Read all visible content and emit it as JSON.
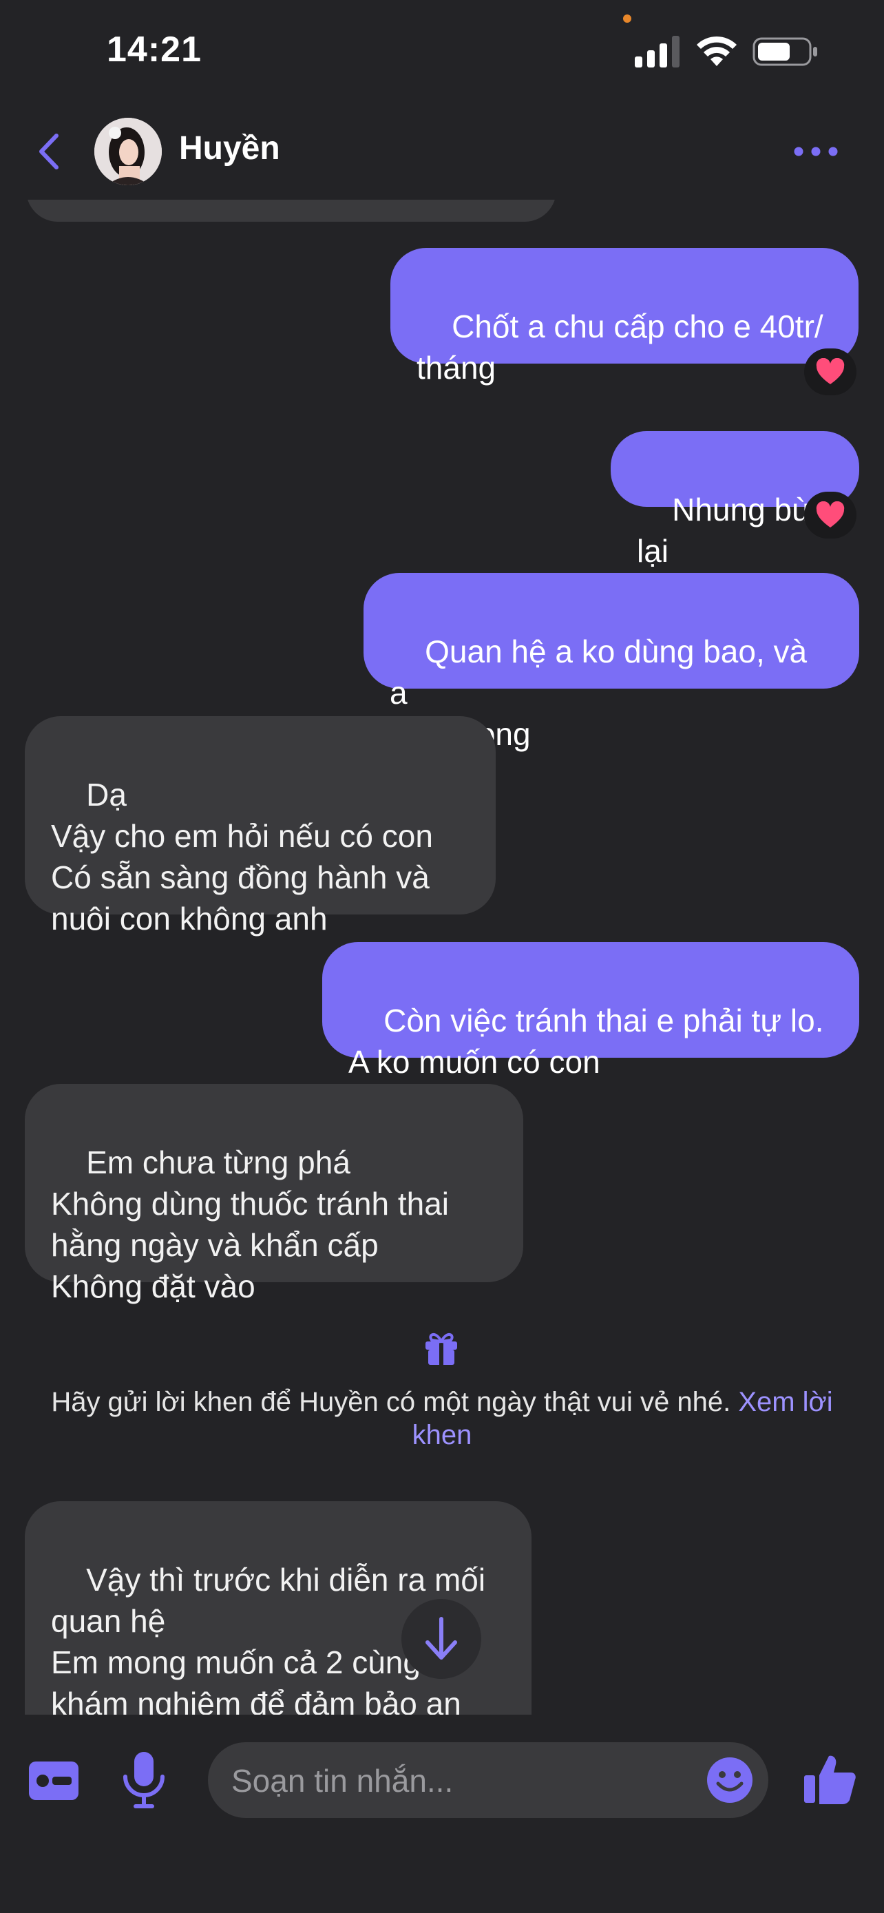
{
  "status_bar": {
    "time": "14:21"
  },
  "header": {
    "contact_name": "Huyền"
  },
  "messages": [
    {
      "direction": "out",
      "text": "Chốt a chu cấp cho e 40tr/\ntháng",
      "reaction": "heart"
    },
    {
      "direction": "out",
      "text": "Nhung bù lại",
      "reaction": "heart"
    },
    {
      "direction": "out",
      "text": "Quan hệ a ko dùng bao, và a\nxuất trong"
    },
    {
      "direction": "in",
      "text": "Dạ\nVậy cho em hỏi nếu có con\nCó sẵn sàng đồng hành và\nnuôi con không anh"
    },
    {
      "direction": "out",
      "text": "Còn việc tránh thai e phải tự lo.\nA ko muốn có con"
    },
    {
      "direction": "in",
      "text": "Em chưa từng phá\nKhông dùng thuốc tránh thai\nhằng ngày và khẩn cấp\nKhông đặt vào"
    },
    {
      "direction": "in",
      "text": "Vậy thì trước khi diễn ra mối\nquan hệ\nEm mong muốn cả 2 cùng đi\nkhám nghiệm để đảm bảo an\ntoàn a"
    }
  ],
  "suggestion": {
    "text": "Hãy gửi lời khen để Huyền có một ngày thật vui vẻ nhé. ",
    "link": "Xem lời khen"
  },
  "composer": {
    "placeholder": "Soạn tin nhắn..."
  },
  "colors": {
    "accent": "#7b6ef5",
    "background": "#232326",
    "incoming_bubble": "#3a3a3d",
    "reaction_heart": "#ff4d7a"
  }
}
